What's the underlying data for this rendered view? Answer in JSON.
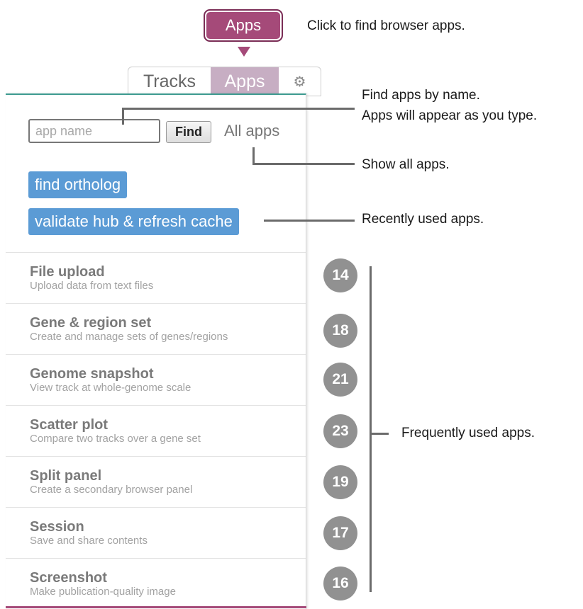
{
  "callout": {
    "label": "Apps"
  },
  "tabs": [
    {
      "label": "Tracks"
    },
    {
      "label": "Apps"
    },
    {
      "label": "⚙"
    }
  ],
  "search": {
    "placeholder": "app name",
    "value": "",
    "find_label": "Find",
    "all_apps_label": "All apps"
  },
  "recent_apps": [
    {
      "label": "find ortholog"
    },
    {
      "label": "validate hub & refresh cache"
    }
  ],
  "apps": [
    {
      "name": "File upload",
      "description": "Upload data from text files",
      "count": "14"
    },
    {
      "name": "Gene & region set",
      "description": "Create and manage sets of genes/regions",
      "count": "18"
    },
    {
      "name": "Genome snapshot",
      "description": "View track at whole-genome scale",
      "count": "21"
    },
    {
      "name": "Scatter plot",
      "description": "Compare two tracks over a gene set",
      "count": "23"
    },
    {
      "name": "Split panel",
      "description": "Create a secondary browser panel",
      "count": "19"
    },
    {
      "name": "Session",
      "description": "Save and share contents",
      "count": "17"
    },
    {
      "name": "Screenshot",
      "description": "Make publication-quality image",
      "count": "16"
    }
  ],
  "annotations": {
    "apps_button": "Click to find browser apps.",
    "find_line1": "Find apps by name.",
    "find_line2": "Apps will appear as you type.",
    "show_all": "Show all apps.",
    "recent": "Recently used apps.",
    "frequent": "Frequently used apps."
  },
  "colors": {
    "accent_purple": "#a54a79",
    "active_tab": "#c7aec3",
    "recent_app_blue": "#5b9bd5",
    "badge_gray": "#919191",
    "panel_top_border": "#3d9a90"
  }
}
